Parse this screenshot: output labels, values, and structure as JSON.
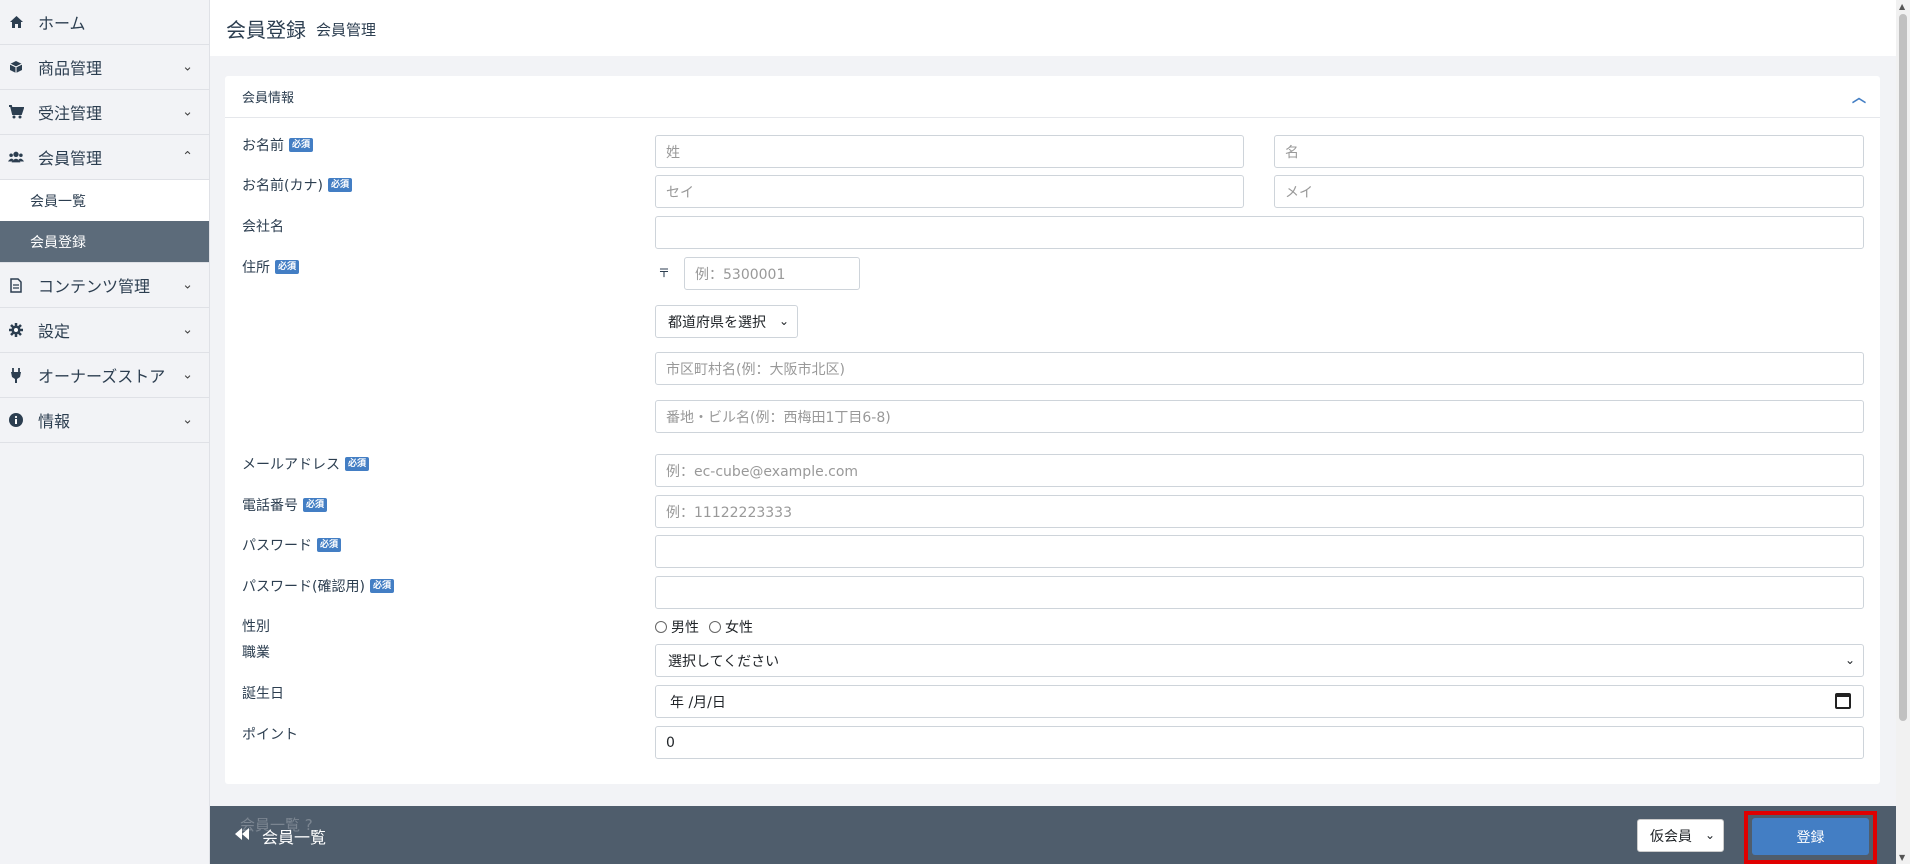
{
  "sidebar": {
    "items": [
      {
        "label": "ホーム",
        "icon": "home-icon"
      },
      {
        "label": "商品管理",
        "icon": "cube-icon"
      },
      {
        "label": "受注管理",
        "icon": "cart-icon"
      },
      {
        "label": "会員管理",
        "icon": "users-icon"
      },
      {
        "label": "コンテンツ管理",
        "icon": "file-icon"
      },
      {
        "label": "設定",
        "icon": "gear-icon"
      },
      {
        "label": "オーナーズストア",
        "icon": "plug-icon"
      },
      {
        "label": "情報",
        "icon": "info-icon"
      }
    ],
    "sub_items": [
      "会員一覧",
      "会員登録"
    ]
  },
  "header": {
    "title": "会員登録",
    "subtitle": "会員管理"
  },
  "card": {
    "title": "会員情報"
  },
  "required_badge": "必須",
  "form": {
    "name_label": "お名前",
    "name_last_placeholder": "姓",
    "name_first_placeholder": "名",
    "kana_label": "お名前(カナ)",
    "kana_last_placeholder": "セイ",
    "kana_first_placeholder": "メイ",
    "company_label": "会社名",
    "address_label": "住所",
    "postal_mark": "〒",
    "postal_placeholder": "例：5300001",
    "pref_select": "都道府県を選択",
    "city_placeholder": "市区町村名(例：大阪市北区)",
    "addr_placeholder": "番地・ビル名(例：西梅田1丁目6-8)",
    "email_label": "メールアドレス",
    "email_placeholder": "例：ec-cube@example.com",
    "phone_label": "電話番号",
    "phone_placeholder": "例：11122223333",
    "password_label": "パスワード",
    "password_confirm_label": "パスワード(確認用)",
    "gender_label": "性別",
    "gender_male": "男性",
    "gender_female": "女性",
    "job_label": "職業",
    "job_select": "選択してください",
    "birthday_label": "誕生日",
    "birthday_placeholder": "年 /月/日",
    "point_label": "ポイント",
    "point_value": "0"
  },
  "footer": {
    "back_label": "会員一覧",
    "ghost_text": "会員一覧 ?",
    "status_select": "仮会員",
    "submit_label": "登録"
  },
  "colors": {
    "accent": "#437ec4",
    "footer": "#4f5d6c",
    "active_sub": "#5c6b7a",
    "highlight": "#e00000"
  }
}
